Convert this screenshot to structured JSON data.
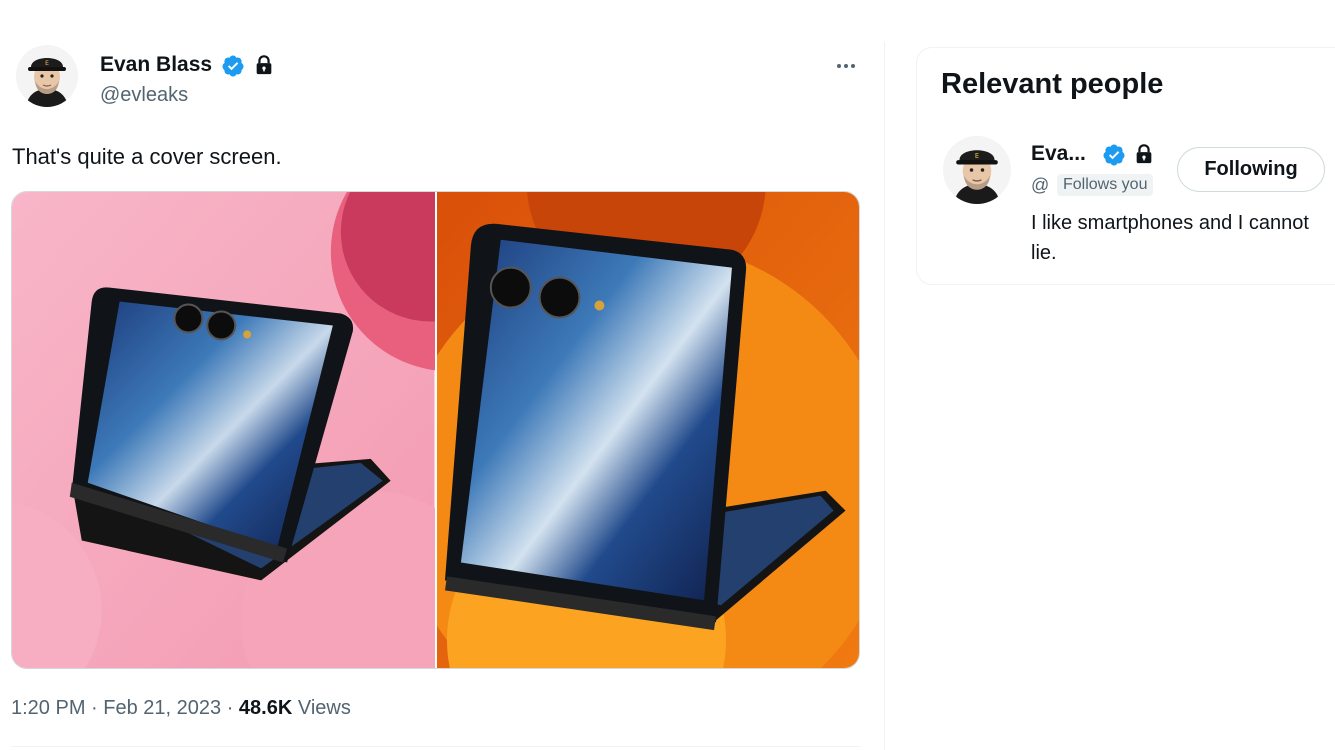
{
  "tweet": {
    "author": {
      "name": "Evan Blass",
      "handle": "@evleaks",
      "avatar_icon": "cartoon-avatar-with-cap",
      "verified_icon": "verified-badge-icon",
      "protected_icon": "lock-icon"
    },
    "more_icon": "more-dots-icon",
    "text": "That's quite a cover screen.",
    "media": [
      {
        "description_icon": "foldable-phone-pink-background",
        "background": "#f7b1c3"
      },
      {
        "description_icon": "foldable-phone-orange-background",
        "background": "#e86a0f"
      }
    ],
    "meta": {
      "time": "1:20 PM",
      "separator1": " · ",
      "date": "Feb 21, 2023",
      "separator2": " · ",
      "views_count": "48.6K",
      "views_label": " Views"
    }
  },
  "relevant_people": {
    "title": "Relevant people",
    "person": {
      "name": "Eva...",
      "handle": "@",
      "follows_you": "Follows you",
      "follow_button": "Following",
      "bio": "I like smartphones and I cannot lie."
    }
  },
  "colors": {
    "text_primary": "#0f1419",
    "text_secondary": "#536471",
    "verified": "#1d9bf0",
    "border": "#cfd9de"
  }
}
